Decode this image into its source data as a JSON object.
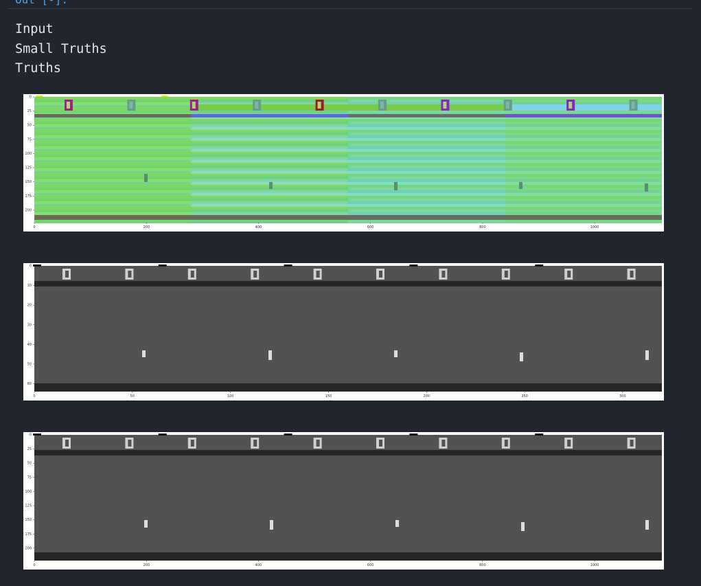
{
  "previous_cell_label": "Out [•]:",
  "output": {
    "lines": [
      "Input",
      "Small Truths",
      "Truths"
    ]
  },
  "colors": {
    "background": "#21252e",
    "text": "#e6e6e6",
    "figure_bg": "#ffffff",
    "gray_frame": "#525252",
    "dark_band": "#262626"
  },
  "figures": [
    {
      "name": "input-figure",
      "image": "plot of input frames (colored game screens)",
      "x_ticks": [
        "0",
        "200",
        "400",
        "600",
        "800",
        "1000"
      ],
      "y_ticks": [
        "0",
        "25",
        "50",
        "75",
        "100",
        "125",
        "150",
        "175",
        "200"
      ]
    },
    {
      "name": "small-truths-figure",
      "image": "plot of downscaled ground-truth frames",
      "x_ticks": [
        "0",
        "50",
        "100",
        "150",
        "200",
        "250",
        "300"
      ],
      "y_ticks": [
        "0",
        "10",
        "20",
        "30",
        "40",
        "50",
        "60"
      ]
    },
    {
      "name": "truths-figure",
      "image": "plot of ground-truth frames",
      "x_ticks": [
        "0",
        "200",
        "400",
        "600",
        "800",
        "1000"
      ],
      "y_ticks": [
        "0",
        "25",
        "50",
        "75",
        "100",
        "125",
        "150",
        "175",
        "200"
      ]
    }
  ]
}
